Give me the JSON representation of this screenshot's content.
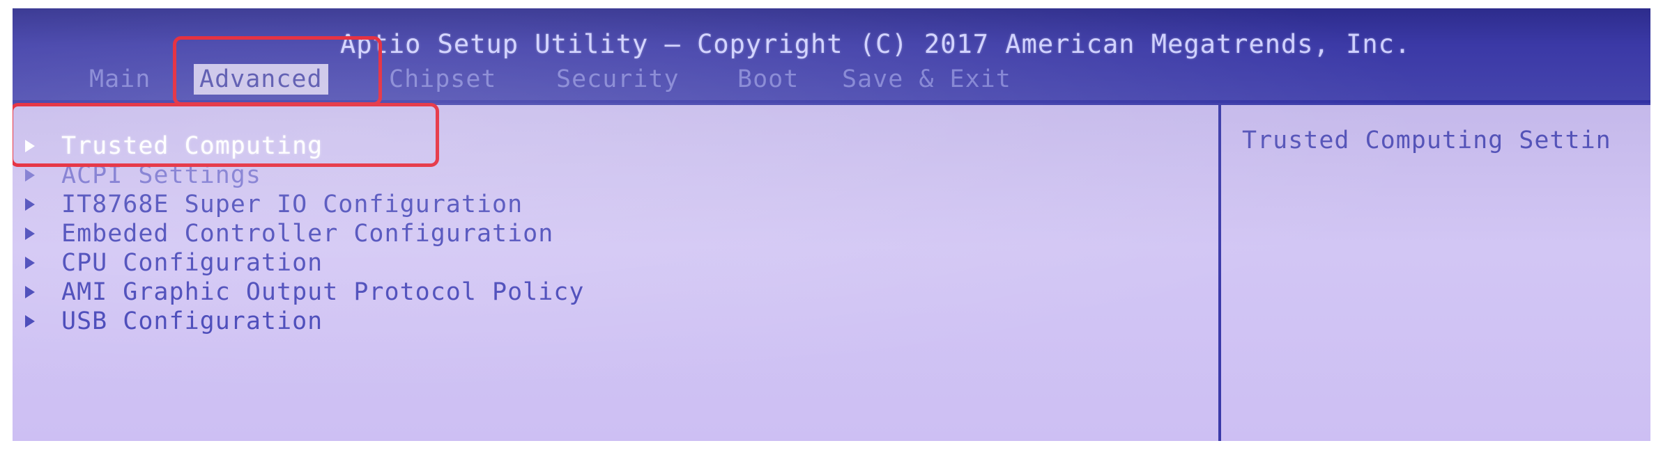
{
  "header": {
    "title": "Aptio Setup Utility – Copyright (C) 2017 American Megatrends, Inc.",
    "tabs": [
      {
        "label": "Main"
      },
      {
        "label": "Advanced"
      },
      {
        "label": "Chipset"
      },
      {
        "label": "Security"
      },
      {
        "label": "Boot"
      },
      {
        "label": "Save & Exit"
      }
    ],
    "active_tab": "Advanced"
  },
  "menu": {
    "items": [
      {
        "label": "Trusted Computing"
      },
      {
        "label": "ACPI Settings"
      },
      {
        "label": "IT8768E Super IO Configuration"
      },
      {
        "label": "Embeded Controller Configuration"
      },
      {
        "label": "CPU Configuration"
      },
      {
        "label": "AMI Graphic Output Protocol Policy"
      },
      {
        "label": "USB Configuration"
      }
    ],
    "selected_item": "Trusted Computing"
  },
  "help": {
    "text": "Trusted Computing Settin"
  },
  "colors": {
    "header_background": "#3b39a6",
    "body_background": "#d2c6f4",
    "menu_text": "#4646b8",
    "selected_text": "#ffffff",
    "callout_red": "#e21a2c"
  },
  "icons": {
    "submenu_marker": "triangle-right-icon"
  }
}
